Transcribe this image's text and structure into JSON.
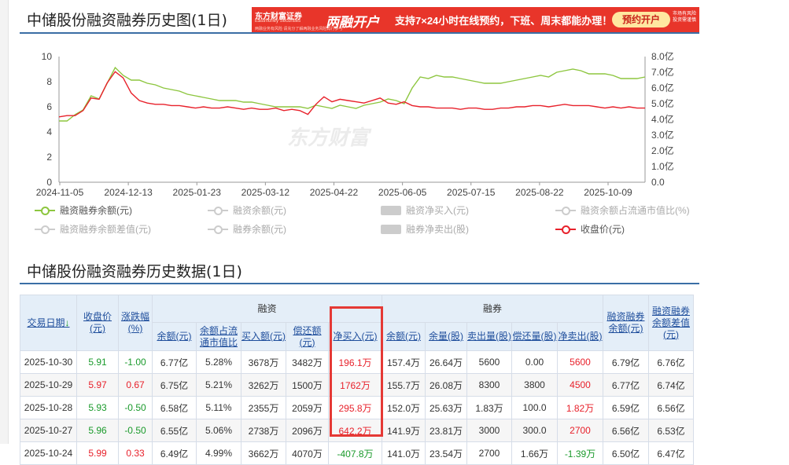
{
  "page": {
    "chart_title": "中储股份融资融券历史图(1日)",
    "table_title": "中储股份融资融券历史数据(1日)",
    "watermark": "东方财富"
  },
  "banner": {
    "logo": "东方财富证券",
    "logo_sub": "Eastmoney Securities",
    "fine": "两融业务有风险 请充分了解两融业务风险再行参与",
    "big": "两融开户",
    "msg": "支持7×24小时在线预约，下班、周末都能办理！",
    "button": "预约开户",
    "risk": "市场有风险 投资需谨慎",
    "brand_color": "#e8352a"
  },
  "legend": [
    {
      "label": "融资融券余额(元)",
      "style": "green",
      "active": true
    },
    {
      "label": "融资余额(元)",
      "style": "grey",
      "active": false
    },
    {
      "label": "融资净买入(元)",
      "style": "box",
      "active": false
    },
    {
      "label": "融资余额占流通市值比(%)",
      "style": "grey",
      "active": false
    },
    {
      "label": "融资融券余额差值(元)",
      "style": "grey",
      "active": false
    },
    {
      "label": "融券余额(元)",
      "style": "grey",
      "active": false
    },
    {
      "label": "融券净卖出(股)",
      "style": "box",
      "active": false
    },
    {
      "label": "收盘价(元)",
      "style": "red",
      "active": true
    }
  ],
  "chart_data": {
    "type": "line",
    "x_ticks": [
      "2024-11-05",
      "2024-12-13",
      "2025-01-23",
      "2025-03-12",
      "2025-04-22",
      "2025-06-05",
      "2025-07-15",
      "2025-08-22",
      "2025-10-09"
    ],
    "y_left_ticks": [
      "0",
      "2",
      "4",
      "6",
      "8",
      "10"
    ],
    "y_left_range": [
      0,
      10
    ],
    "y_right_ticks": [
      "0.0",
      "1.0亿",
      "2.0亿",
      "3.0亿",
      "4.0亿",
      "5.0亿",
      "6.0亿",
      "7.0亿",
      "8.0亿"
    ],
    "y_right_range": [
      0,
      8
    ],
    "series": [
      {
        "name": "融资融券余额(元)",
        "axis": "right",
        "color": "#8dc63f",
        "values": [
          3.9,
          3.9,
          4.3,
          4.6,
          5.5,
          5.3,
          6.3,
          7.3,
          6.8,
          6.5,
          6.5,
          6.3,
          6.2,
          6.0,
          5.9,
          5.8,
          5.6,
          5.5,
          5.4,
          5.3,
          5.2,
          5.2,
          5.2,
          5.1,
          5.1,
          5.0,
          4.9,
          4.8,
          4.8,
          4.8,
          4.8,
          4.7,
          4.9,
          4.8,
          4.7,
          4.9,
          4.8,
          4.7,
          4.9,
          5.0,
          5.1,
          5.3,
          5.2,
          5.0,
          6.0,
          6.7,
          6.6,
          6.8,
          6.7,
          6.7,
          6.6,
          6.5,
          6.4,
          6.3,
          6.3,
          6.3,
          6.4,
          6.5,
          6.6,
          6.7,
          6.8,
          6.7,
          7.0,
          7.1,
          7.2,
          7.1,
          6.9,
          6.9,
          6.9,
          6.8,
          6.6,
          6.6,
          6.6,
          6.7
        ]
      },
      {
        "name": "收盘价(元)",
        "axis": "left",
        "color": "#e8212b",
        "values": [
          5.2,
          5.3,
          5.3,
          5.7,
          6.7,
          6.6,
          7.9,
          8.8,
          8.3,
          7.1,
          6.5,
          6.3,
          6.2,
          6.2,
          6.1,
          6.1,
          6.0,
          5.9,
          6.0,
          5.9,
          5.9,
          6.0,
          5.9,
          5.8,
          5.9,
          5.8,
          5.8,
          5.9,
          5.7,
          5.8,
          5.7,
          5.4,
          6.2,
          6.8,
          6.4,
          6.6,
          6.5,
          6.4,
          6.3,
          6.5,
          6.7,
          6.3,
          6.2,
          6.4,
          6.1,
          6.0,
          6.0,
          5.9,
          5.9,
          5.9,
          5.8,
          5.9,
          5.9,
          5.8,
          5.8,
          5.9,
          5.9,
          6.0,
          6.0,
          6.1,
          6.1,
          6.0,
          6.1,
          6.2,
          6.1,
          6.1,
          6.1,
          6.0,
          5.9,
          6.0,
          5.9,
          6.0,
          5.9,
          5.9
        ]
      }
    ]
  },
  "table": {
    "group_rongzi": "融资",
    "group_rongquan": "融券",
    "headers": {
      "date": "交易日期",
      "close": "收盘价(元)",
      "chg": "涨跌幅(%)",
      "rz_balance": "余额(元)",
      "rz_ratio": "余额占流通市值比",
      "rz_buy": "买入额(元)",
      "rz_repay": "偿还额(元)",
      "rz_net": "净买入(元)",
      "rq_balance": "余额(元)",
      "rq_qty": "余量(股)",
      "rq_sell": "卖出量(股)",
      "rq_repay": "偿还量(股)",
      "rq_net": "净卖出(股)",
      "total": "融资融券余额(元)",
      "diff": "融资融券余额差值(元)"
    },
    "rows": [
      {
        "date": "2025-10-30",
        "close": "5.91",
        "chg": "-1.00",
        "rz_balance": "6.77亿",
        "rz_ratio": "5.28%",
        "rz_buy": "3678万",
        "rz_repay": "3482万",
        "rz_net": "196.1万",
        "rq_balance": "157.4万",
        "rq_qty": "26.64万",
        "rq_sell": "5600",
        "rq_repay": "0.00",
        "rq_net": "5600",
        "total": "6.79亿",
        "diff": "6.76亿",
        "dir": "down"
      },
      {
        "date": "2025-10-29",
        "close": "5.97",
        "chg": "0.67",
        "rz_balance": "6.75亿",
        "rz_ratio": "5.21%",
        "rz_buy": "3262万",
        "rz_repay": "1500万",
        "rz_net": "1762万",
        "rq_balance": "155.7万",
        "rq_qty": "26.08万",
        "rq_sell": "8300",
        "rq_repay": "3800",
        "rq_net": "4500",
        "total": "6.77亿",
        "diff": "6.74亿",
        "dir": "up"
      },
      {
        "date": "2025-10-28",
        "close": "5.93",
        "chg": "-0.50",
        "rz_balance": "6.58亿",
        "rz_ratio": "5.11%",
        "rz_buy": "2355万",
        "rz_repay": "2059万",
        "rz_net": "295.8万",
        "rq_balance": "152.0万",
        "rq_qty": "25.63万",
        "rq_sell": "1.83万",
        "rq_repay": "100.0",
        "rq_net": "1.82万",
        "total": "6.59亿",
        "diff": "6.56亿",
        "dir": "down"
      },
      {
        "date": "2025-10-27",
        "close": "5.96",
        "chg": "-0.50",
        "rz_balance": "6.55亿",
        "rz_ratio": "5.06%",
        "rz_buy": "2738万",
        "rz_repay": "2096万",
        "rz_net": "642.2万",
        "rq_balance": "141.9万",
        "rq_qty": "23.81万",
        "rq_sell": "3000",
        "rq_repay": "300.0",
        "rq_net": "2700",
        "total": "6.56亿",
        "diff": "6.53亿",
        "dir": "down"
      },
      {
        "date": "2025-10-24",
        "close": "5.99",
        "chg": "0.33",
        "rz_balance": "6.49亿",
        "rz_ratio": "4.99%",
        "rz_buy": "3662万",
        "rz_repay": "4070万",
        "rz_net": "-407.8万",
        "rq_balance": "141.0万",
        "rq_qty": "23.54万",
        "rq_sell": "2700",
        "rq_repay": "1.66万",
        "rq_net": "-1.39万",
        "total": "6.50亿",
        "diff": "6.47亿",
        "dir": "up"
      }
    ]
  }
}
